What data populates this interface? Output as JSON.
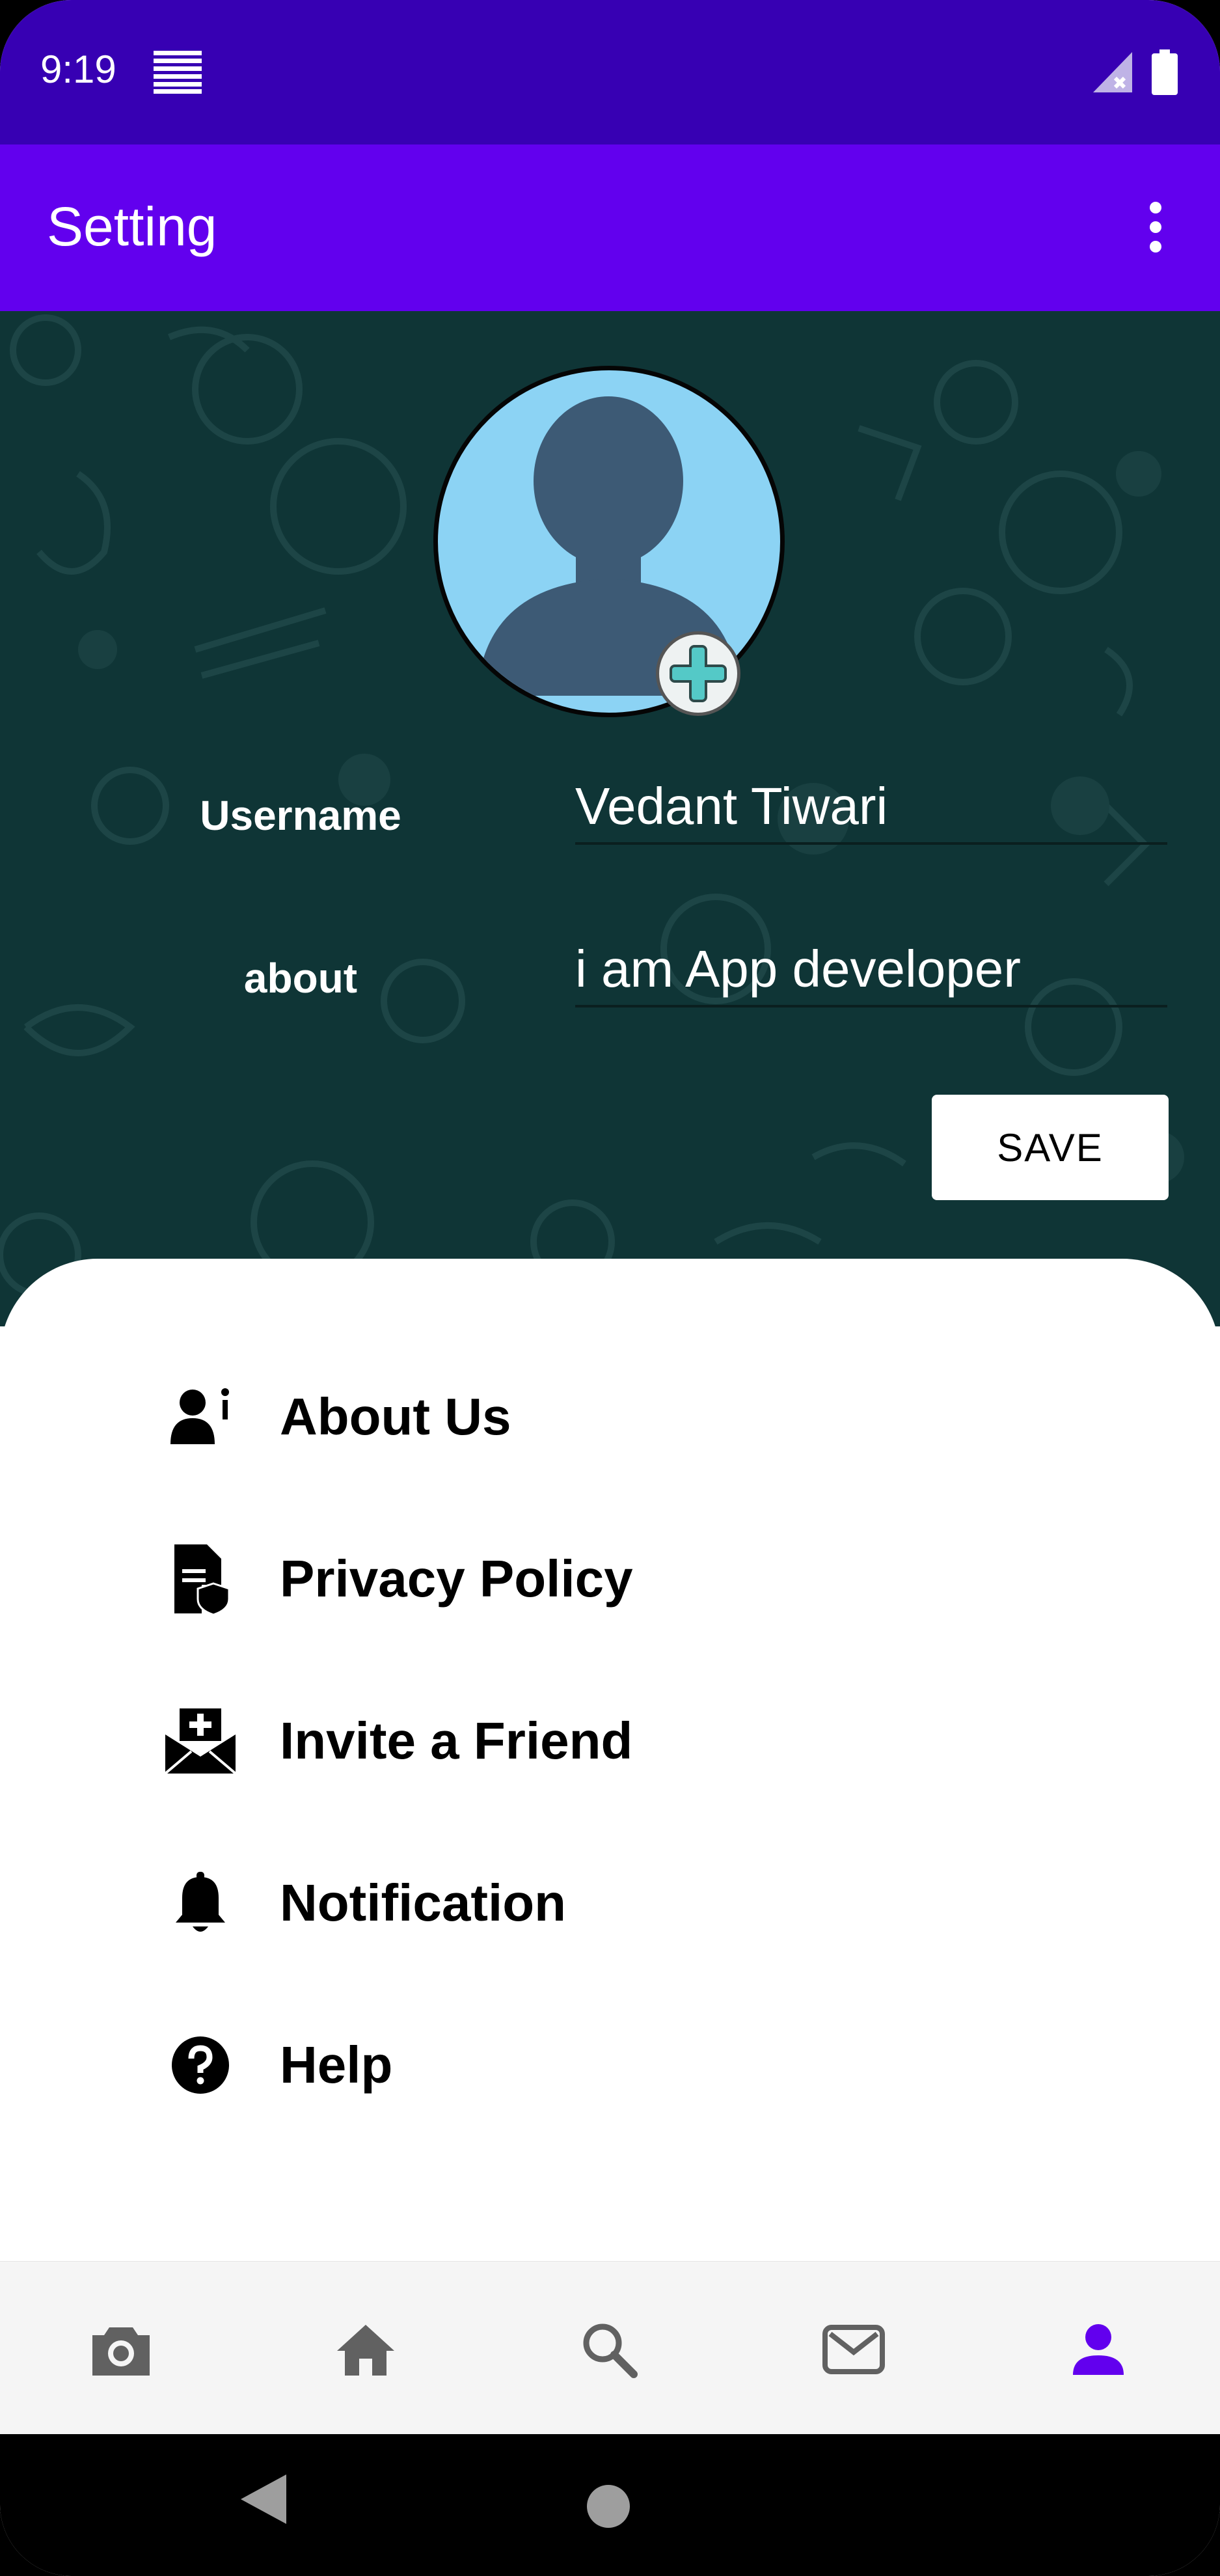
{
  "status_bar": {
    "time": "9:19",
    "icons": [
      "notification-lines-icon",
      "signal-off-icon",
      "battery-icon"
    ]
  },
  "app_bar": {
    "title": "Setting",
    "menu_icon": "more-vert-icon",
    "color": "#6200EE"
  },
  "profile": {
    "username_label": "Username",
    "username_value": "Vedant Tiwari",
    "about_label": "about",
    "about_value": "i am App developer",
    "save_label": "SAVE",
    "avatar_icon": "person-silhouette-icon",
    "add_photo_icon": "plus-circle-icon"
  },
  "menu": {
    "items": [
      {
        "label": "About Us",
        "icon": "user-info-icon"
      },
      {
        "label": "Privacy Policy",
        "icon": "document-shield-icon"
      },
      {
        "label": "Invite a Friend",
        "icon": "envelope-plus-icon"
      },
      {
        "label": "Notification",
        "icon": "bell-icon"
      },
      {
        "label": "Help",
        "icon": "help-circle-icon"
      }
    ]
  },
  "bottom_nav": {
    "items": [
      {
        "icon": "camera-icon",
        "active": false
      },
      {
        "icon": "home-icon",
        "active": false
      },
      {
        "icon": "search-icon",
        "active": false
      },
      {
        "icon": "mail-icon",
        "active": false
      },
      {
        "icon": "profile-icon",
        "active": true
      }
    ],
    "active_color": "#6200EE",
    "inactive_color": "#616161"
  },
  "colors": {
    "status_bar": "#3700B3",
    "header_bg": "#0f3536",
    "avatar_bg": "#8cd3f4"
  }
}
